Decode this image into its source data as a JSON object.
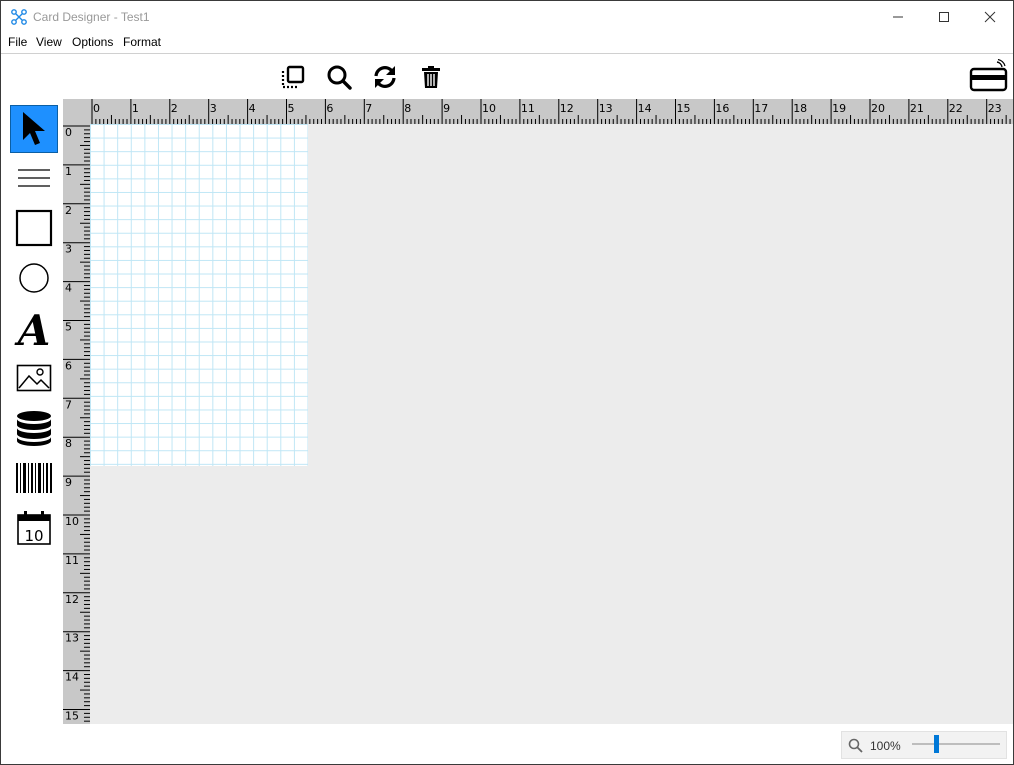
{
  "window": {
    "title": "Card Designer - Test1"
  },
  "menu": [
    {
      "label": "File"
    },
    {
      "label": "View"
    },
    {
      "label": "Options"
    },
    {
      "label": "Format"
    }
  ],
  "toolbar": [
    {
      "name": "fit-selection-button",
      "icon": "select-frame-icon"
    },
    {
      "name": "zoom-button",
      "icon": "search-icon"
    },
    {
      "name": "refresh-button",
      "icon": "sync-icon"
    },
    {
      "name": "delete-button",
      "icon": "trash-icon"
    }
  ],
  "card_button": {
    "icon": "credit-card-contactless-icon"
  },
  "tools": [
    {
      "name": "pointer",
      "icon": "arrow-cursor-icon",
      "selected": true
    },
    {
      "name": "line",
      "icon": "lines-icon"
    },
    {
      "name": "rectangle",
      "icon": "square-icon"
    },
    {
      "name": "ellipse",
      "icon": "circle-icon"
    },
    {
      "name": "text",
      "icon": "letter-a-icon",
      "glyph": "A"
    },
    {
      "name": "image",
      "icon": "image-icon"
    },
    {
      "name": "database",
      "icon": "database-icon"
    },
    {
      "name": "barcode",
      "icon": "barcode-icon"
    },
    {
      "name": "date",
      "icon": "calendar-icon",
      "glyph": "10"
    }
  ],
  "ruler": {
    "horizontal_labels": [
      "0",
      "1",
      "2",
      "3",
      "4",
      "5",
      "6",
      "7",
      "8",
      "9",
      "10",
      "11",
      "12",
      "13",
      "14",
      "15",
      "16",
      "17",
      "18",
      "19",
      "20",
      "21",
      "22",
      "23"
    ],
    "vertical_labels": [
      "0",
      "1",
      "2",
      "3",
      "4",
      "5",
      "6",
      "7",
      "8",
      "9",
      "10",
      "11",
      "12",
      "13",
      "14",
      "15"
    ]
  },
  "status": {
    "zoom_label": "100%",
    "zoom_level": 100
  },
  "colors": {
    "tool_selected": "#1e90ff",
    "grid_line": "#bfe6f5",
    "canvas_bg": "#ececec",
    "ruler_bg": "#c8c8c8",
    "slider_accent": "#0078d7"
  }
}
